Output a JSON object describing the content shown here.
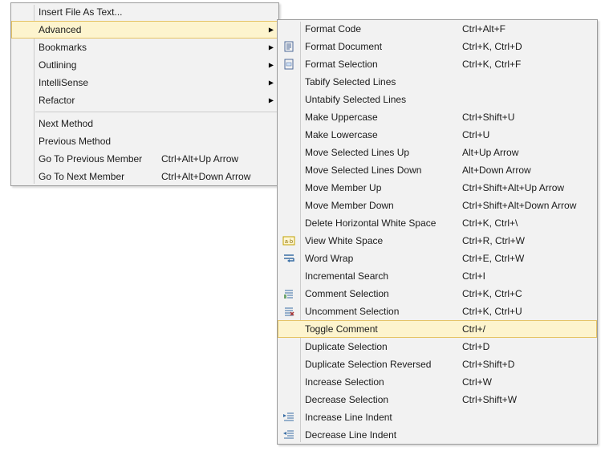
{
  "left_menu": {
    "items": [
      {
        "type": "item",
        "label": "Insert File As Text...",
        "shortcut": "",
        "submenu": false,
        "icon": null,
        "highlight": false
      },
      {
        "type": "item",
        "label": "Advanced",
        "shortcut": "",
        "submenu": true,
        "icon": null,
        "highlight": true
      },
      {
        "type": "item",
        "label": "Bookmarks",
        "shortcut": "",
        "submenu": true,
        "icon": null,
        "highlight": false
      },
      {
        "type": "item",
        "label": "Outlining",
        "shortcut": "",
        "submenu": true,
        "icon": null,
        "highlight": false
      },
      {
        "type": "item",
        "label": "IntelliSense",
        "shortcut": "",
        "submenu": true,
        "icon": null,
        "highlight": false
      },
      {
        "type": "item",
        "label": "Refactor",
        "shortcut": "",
        "submenu": true,
        "icon": null,
        "highlight": false
      },
      {
        "type": "separator"
      },
      {
        "type": "item",
        "label": "Next Method",
        "shortcut": "",
        "submenu": false,
        "icon": null,
        "highlight": false
      },
      {
        "type": "item",
        "label": "Previous Method",
        "shortcut": "",
        "submenu": false,
        "icon": null,
        "highlight": false
      },
      {
        "type": "item",
        "label": "Go To Previous Member",
        "shortcut": "Ctrl+Alt+Up Arrow",
        "submenu": false,
        "icon": null,
        "highlight": false
      },
      {
        "type": "item",
        "label": "Go To Next Member",
        "shortcut": "Ctrl+Alt+Down Arrow",
        "submenu": false,
        "icon": null,
        "highlight": false
      }
    ]
  },
  "right_menu": {
    "items": [
      {
        "type": "item",
        "label": "Format Code",
        "shortcut": "Ctrl+Alt+F",
        "submenu": false,
        "icon": null,
        "highlight": false
      },
      {
        "type": "item",
        "label": "Format Document",
        "shortcut": "Ctrl+K, Ctrl+D",
        "submenu": false,
        "icon": "format-document-icon",
        "highlight": false
      },
      {
        "type": "item",
        "label": "Format Selection",
        "shortcut": "Ctrl+K, Ctrl+F",
        "submenu": false,
        "icon": "format-selection-icon",
        "highlight": false
      },
      {
        "type": "item",
        "label": "Tabify Selected Lines",
        "shortcut": "",
        "submenu": false,
        "icon": null,
        "highlight": false
      },
      {
        "type": "item",
        "label": "Untabify Selected Lines",
        "shortcut": "",
        "submenu": false,
        "icon": null,
        "highlight": false
      },
      {
        "type": "item",
        "label": "Make Uppercase",
        "shortcut": "Ctrl+Shift+U",
        "submenu": false,
        "icon": null,
        "highlight": false
      },
      {
        "type": "item",
        "label": "Make Lowercase",
        "shortcut": "Ctrl+U",
        "submenu": false,
        "icon": null,
        "highlight": false
      },
      {
        "type": "item",
        "label": "Move Selected Lines Up",
        "shortcut": "Alt+Up Arrow",
        "submenu": false,
        "icon": null,
        "highlight": false
      },
      {
        "type": "item",
        "label": "Move Selected Lines Down",
        "shortcut": "Alt+Down Arrow",
        "submenu": false,
        "icon": null,
        "highlight": false
      },
      {
        "type": "item",
        "label": "Move Member Up",
        "shortcut": "Ctrl+Shift+Alt+Up Arrow",
        "submenu": false,
        "icon": null,
        "highlight": false
      },
      {
        "type": "item",
        "label": "Move Member Down",
        "shortcut": "Ctrl+Shift+Alt+Down Arrow",
        "submenu": false,
        "icon": null,
        "highlight": false
      },
      {
        "type": "item",
        "label": "Delete Horizontal White Space",
        "shortcut": "Ctrl+K, Ctrl+\\",
        "submenu": false,
        "icon": null,
        "highlight": false
      },
      {
        "type": "item",
        "label": "View White Space",
        "shortcut": "Ctrl+R, Ctrl+W",
        "submenu": false,
        "icon": "view-white-space-icon",
        "highlight": false
      },
      {
        "type": "item",
        "label": "Word Wrap",
        "shortcut": "Ctrl+E, Ctrl+W",
        "submenu": false,
        "icon": "word-wrap-icon",
        "highlight": false
      },
      {
        "type": "item",
        "label": "Incremental Search",
        "shortcut": "Ctrl+I",
        "submenu": false,
        "icon": null,
        "highlight": false
      },
      {
        "type": "item",
        "label": "Comment Selection",
        "shortcut": "Ctrl+K, Ctrl+C",
        "submenu": false,
        "icon": "comment-selection-icon",
        "highlight": false
      },
      {
        "type": "item",
        "label": "Uncomment Selection",
        "shortcut": "Ctrl+K, Ctrl+U",
        "submenu": false,
        "icon": "uncomment-selection-icon",
        "highlight": false
      },
      {
        "type": "item",
        "label": "Toggle Comment",
        "shortcut": "Ctrl+/",
        "submenu": false,
        "icon": null,
        "highlight": true
      },
      {
        "type": "item",
        "label": "Duplicate Selection",
        "shortcut": "Ctrl+D",
        "submenu": false,
        "icon": null,
        "highlight": false
      },
      {
        "type": "item",
        "label": "Duplicate Selection Reversed",
        "shortcut": "Ctrl+Shift+D",
        "submenu": false,
        "icon": null,
        "highlight": false
      },
      {
        "type": "item",
        "label": "Increase Selection",
        "shortcut": "Ctrl+W",
        "submenu": false,
        "icon": null,
        "highlight": false
      },
      {
        "type": "item",
        "label": "Decrease Selection",
        "shortcut": "Ctrl+Shift+W",
        "submenu": false,
        "icon": null,
        "highlight": false
      },
      {
        "type": "item",
        "label": "Increase Line Indent",
        "shortcut": "",
        "submenu": false,
        "icon": "increase-indent-icon",
        "highlight": false
      },
      {
        "type": "item",
        "label": "Decrease Line Indent",
        "shortcut": "",
        "submenu": false,
        "icon": "decrease-indent-icon",
        "highlight": false
      }
    ]
  }
}
